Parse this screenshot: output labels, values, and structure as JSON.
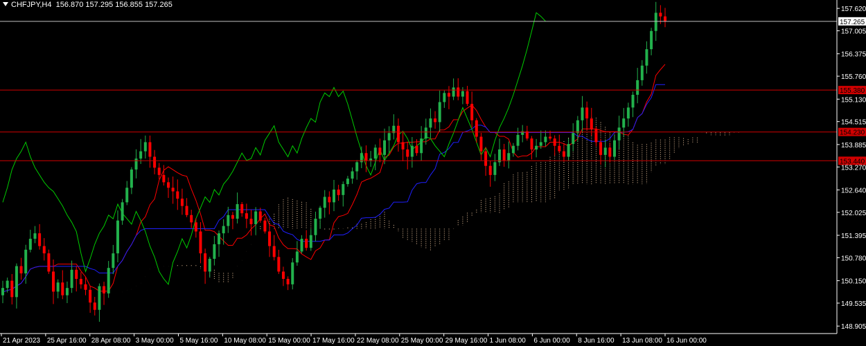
{
  "header": {
    "symbol": "CHFJPY,H4",
    "ohlc": "156.870 157.295 156.855 157.265"
  },
  "chart_data": {
    "type": "candlestick",
    "ylim": [
      148.7,
      157.85
    ],
    "y_ticks": [
      "157.620",
      "157.005",
      "156.375",
      "155.760",
      "155.130",
      "154.515",
      "153.885",
      "153.270",
      "152.640",
      "152.025",
      "151.395",
      "150.780",
      "150.150",
      "149.535",
      "148.905"
    ],
    "x_ticks": [
      "21 Apr 2023",
      "25 Apr 16:00",
      "28 Apr 08:00",
      "3 May 00:00",
      "5 May 16:00",
      "10 May 08:00",
      "15 May 00:00",
      "17 May 16:00",
      "22 May 08:00",
      "25 May 00:00",
      "29 May 16:00",
      "1 Jun 08:00",
      "6 Jun 00:00",
      "8 Jun 16:00",
      "13 Jun 08:00",
      "16 Jun 00:00"
    ],
    "hlines": [
      {
        "label": "157.265",
        "value": 157.265,
        "color": "#c0c0c0",
        "label_bg": "#ffffff",
        "label_fg": "#000000"
      },
      {
        "label": "155.380",
        "value": 155.38,
        "color": "#d10000",
        "label_bg": "#d10000",
        "label_fg": "#000000"
      },
      {
        "label": "154.230",
        "value": 154.23,
        "color": "#d10000",
        "label_bg": "#d10000",
        "label_fg": "#000000"
      },
      {
        "label": "153.440",
        "value": 153.44,
        "color": "#d10000",
        "label_bg": "#d10000",
        "label_fg": "#000000"
      }
    ],
    "colors": {
      "bull": "#22b14c",
      "bear": "#ff0000",
      "tenkan": "#ff0000",
      "kijun": "#1f1fff",
      "chikou": "#00cc00",
      "cloud": "#f0c8a0",
      "grid_text": "#ffffff",
      "axis": "#ffffff"
    },
    "candles": [
      149.95,
      150.15,
      149.7,
      150.55,
      150.35,
      151.0,
      151.3,
      151.45,
      151.1,
      150.9,
      150.4,
      149.85,
      150.1,
      149.75,
      149.95,
      150.45,
      150.2,
      150.05,
      149.9,
      149.55,
      149.35,
      150.0,
      149.8,
      150.5,
      150.9,
      151.8,
      152.3,
      152.7,
      153.2,
      153.5,
      153.7,
      153.95,
      153.55,
      153.25,
      153.05,
      152.85,
      152.7,
      152.6,
      152.4,
      152.2,
      151.95,
      151.75,
      151.5,
      150.9,
      150.4,
      150.75,
      151.15,
      151.45,
      151.65,
      151.95,
      151.85,
      152.25,
      152.0,
      151.85,
      151.7,
      152.05,
      151.8,
      151.5,
      151.1,
      150.8,
      150.4,
      150.2,
      150.05,
      150.65,
      150.95,
      151.3,
      151.05,
      151.4,
      151.85,
      152.15,
      152.45,
      152.3,
      152.65,
      152.5,
      152.8,
      152.95,
      153.15,
      153.4,
      153.65,
      153.45,
      153.5,
      153.8,
      153.6,
      154.0,
      154.2,
      154.4,
      153.95,
      153.75,
      153.55,
      153.85,
      153.65,
      154.05,
      154.35,
      154.6,
      154.5,
      155.05,
      155.3,
      155.2,
      155.45,
      155.2,
      155.35,
      155.0,
      154.55,
      154.1,
      153.7,
      153.3,
      153.05,
      153.4,
      153.75,
      153.45,
      153.65,
      153.85,
      154.15,
      154.25,
      154.05,
      153.75,
      153.85,
      153.95,
      154.1,
      154.05,
      153.85,
      153.7,
      153.55,
      153.9,
      154.2,
      154.55,
      154.9,
      154.6,
      154.3,
      153.95,
      153.6,
      153.8,
      153.55,
      154.0,
      154.35,
      154.6,
      154.9,
      155.25,
      155.65,
      156.05,
      156.5,
      157.0,
      157.5,
      157.4,
      157.27
    ]
  }
}
